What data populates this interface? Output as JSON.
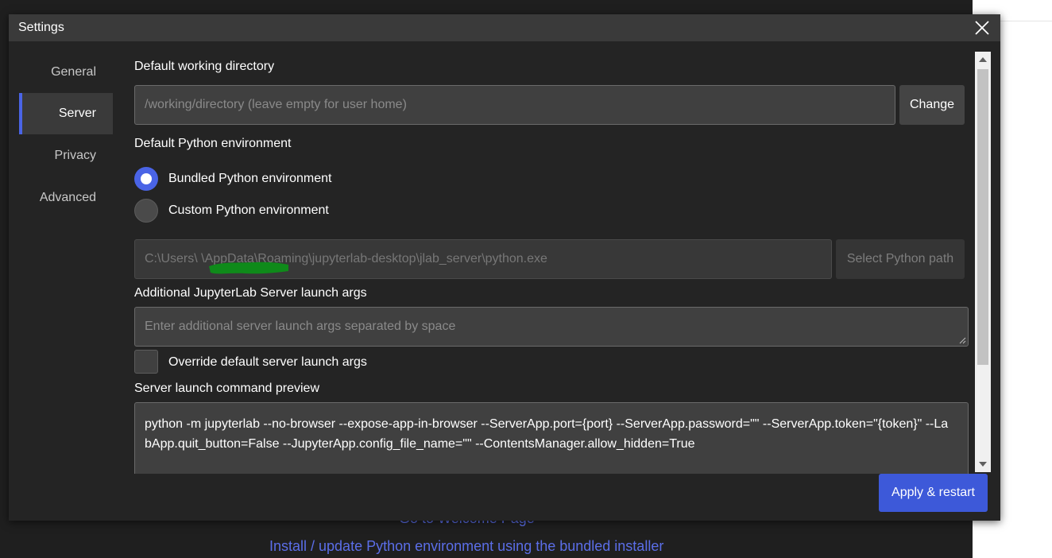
{
  "background": {
    "links": [
      "Go to Welcome Page",
      "Install / update Python environment using the bundled installer"
    ]
  },
  "dialog": {
    "title": "Settings",
    "sidebar": [
      {
        "label": "General",
        "active": false
      },
      {
        "label": "Server",
        "active": true
      },
      {
        "label": "Privacy",
        "active": false
      },
      {
        "label": "Advanced",
        "active": false
      }
    ],
    "working_directory": {
      "label": "Default working directory",
      "placeholder": "/working/directory (leave empty for user home)",
      "change_button": "Change"
    },
    "python_environment": {
      "label": "Default Python environment",
      "options": [
        {
          "label": "Bundled Python environment",
          "selected": true
        },
        {
          "label": "Custom Python environment",
          "selected": false
        }
      ],
      "path_value": "C:\\Users\\ \\AppData\\Roaming\\jupyterlab-desktop\\jlab_server\\python.exe",
      "select_path_button": "Select Python path"
    },
    "launch_args": {
      "label": "Additional JupyterLab Server launch args",
      "placeholder": "Enter additional server launch args separated by space"
    },
    "override": {
      "label": "Override default server launch args",
      "checked": false
    },
    "preview": {
      "label": "Server launch command preview",
      "command": "python -m jupyterlab --no-browser --expose-app-in-browser --ServerApp.port={port} --ServerApp.password=\"\" --ServerApp.token=\"{token}\" --LabApp.quit_button=False --JupyterApp.config_file_name=\"\" --ContentsManager.allow_hidden=True"
    },
    "apply_button": "Apply & restart"
  },
  "colors": {
    "accent": "#4a64e6",
    "apply": "#3d59d9",
    "link": "#5b6ee8",
    "redaction": "#0f8a1a"
  }
}
